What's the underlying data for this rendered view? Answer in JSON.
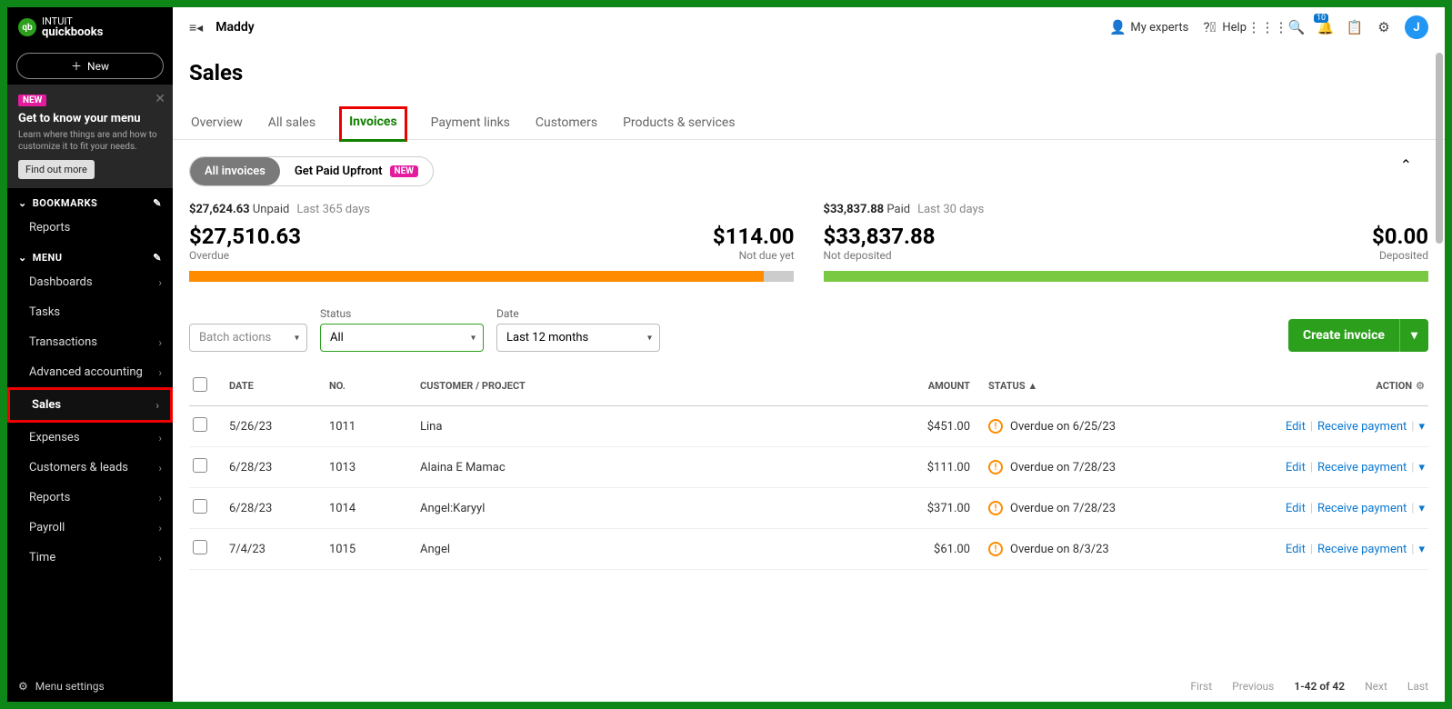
{
  "header": {
    "user": "Maddy",
    "experts": "My experts",
    "help": "Help",
    "bell_count": "10",
    "avatar_letter": "J"
  },
  "sidebar": {
    "logo_brand": "INTUIT",
    "logo_product": "quickbooks",
    "new_btn": "New",
    "banner": {
      "badge": "NEW",
      "title": "Get to know your menu",
      "body": "Learn where things are and how to customize it to fit your needs.",
      "cta": "Find out more"
    },
    "bookmarks_label": "BOOKMARKS",
    "bookmark_items": [
      "Reports"
    ],
    "menu_label": "MENU",
    "menu_items": [
      {
        "label": "Dashboards",
        "chev": true
      },
      {
        "label": "Tasks",
        "chev": false
      },
      {
        "label": "Transactions",
        "chev": true
      },
      {
        "label": "Advanced accounting",
        "chev": true
      },
      {
        "label": "Sales",
        "chev": true,
        "hi": true,
        "active": true
      },
      {
        "label": "Expenses",
        "chev": true
      },
      {
        "label": "Customers & leads",
        "chev": true
      },
      {
        "label": "Reports",
        "chev": true
      },
      {
        "label": "Payroll",
        "chev": true
      },
      {
        "label": "Time",
        "chev": true
      }
    ],
    "settings": "Menu settings"
  },
  "page": {
    "title": "Sales",
    "tabs": [
      "Overview",
      "All sales",
      "Invoices",
      "Payment links",
      "Customers",
      "Products & services"
    ],
    "active_tab": 2,
    "pill_all": "All invoices",
    "pill_upfront": "Get Paid Upfront",
    "pill_new": "NEW"
  },
  "summary": {
    "unpaid_total": "$27,624.63",
    "unpaid_label": "Unpaid",
    "unpaid_days": "Last 365 days",
    "overdue_val": "$27,510.63",
    "overdue_lab": "Overdue",
    "notdue_val": "$114.00",
    "notdue_lab": "Not due yet",
    "paid_total": "$33,837.88",
    "paid_label": "Paid",
    "paid_days": "Last 30 days",
    "notdep_val": "$33,837.88",
    "notdep_lab": "Not deposited",
    "dep_val": "$0.00",
    "dep_lab": "Deposited"
  },
  "filters": {
    "batch": "Batch actions",
    "status_label": "Status",
    "status_val": "All",
    "date_label": "Date",
    "date_val": "Last 12 months",
    "create": "Create invoice"
  },
  "table": {
    "cols": {
      "date": "DATE",
      "no": "NO.",
      "cust": "CUSTOMER / PROJECT",
      "amt": "AMOUNT",
      "status": "STATUS ▲",
      "action": "ACTION"
    },
    "actions": {
      "edit": "Edit",
      "receive": "Receive payment"
    },
    "rows": [
      {
        "date": "5/26/23",
        "no": "1011",
        "cust": "Lina",
        "amt": "$451.00",
        "status": "Overdue on 6/25/23"
      },
      {
        "date": "6/28/23",
        "no": "1013",
        "cust": "Alaina E Mamac",
        "amt": "$111.00",
        "status": "Overdue on 7/28/23"
      },
      {
        "date": "6/28/23",
        "no": "1014",
        "cust": "Angel:Karyyl",
        "amt": "$371.00",
        "status": "Overdue on 7/28/23"
      },
      {
        "date": "7/4/23",
        "no": "1015",
        "cust": "Angel",
        "amt": "$61.00",
        "status": "Overdue on 8/3/23"
      }
    ]
  },
  "paging": {
    "first": "First",
    "prev": "Previous",
    "range": "1-42 of 42",
    "next": "Next",
    "last": "Last"
  }
}
